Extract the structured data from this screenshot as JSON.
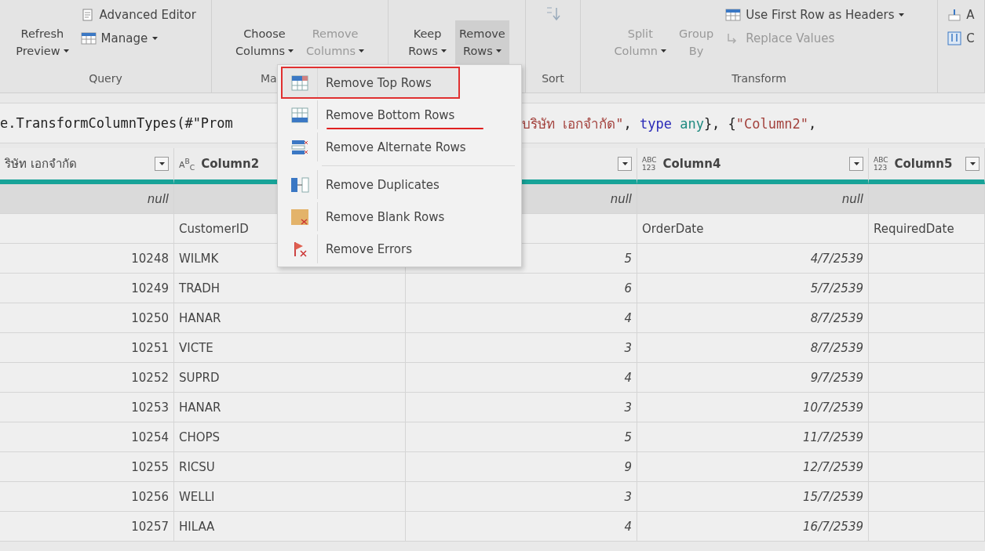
{
  "ribbon": {
    "groups": [
      {
        "label": "Query",
        "items": [
          {
            "kind": "large",
            "lines": [
              "Refresh",
              "Preview"
            ],
            "dropdown": true,
            "disabled": false,
            "pressed": false
          },
          {
            "kind": "stack",
            "items": [
              {
                "label": "Advanced Editor",
                "dropdown": false,
                "disabled": false
              },
              {
                "label": "Manage",
                "dropdown": true,
                "disabled": false
              }
            ]
          }
        ]
      },
      {
        "label": "Ma",
        "items": [
          {
            "kind": "large",
            "lines": [
              "Choose",
              "Columns"
            ],
            "dropdown": true,
            "disabled": false,
            "pressed": false
          },
          {
            "kind": "large",
            "lines": [
              "Remove",
              "Columns"
            ],
            "dropdown": true,
            "disabled": true,
            "pressed": false
          }
        ]
      },
      {
        "items": [
          {
            "kind": "large",
            "lines": [
              "Keep",
              "Rows"
            ],
            "dropdown": true,
            "disabled": false,
            "pressed": false
          },
          {
            "kind": "large",
            "lines": [
              "Remove",
              "Rows"
            ],
            "dropdown": true,
            "disabled": false,
            "pressed": true
          }
        ]
      },
      {
        "label": "Sort",
        "items": [
          {
            "kind": "sorticon"
          }
        ]
      },
      {
        "label": "Transform",
        "items": [
          {
            "kind": "large",
            "lines": [
              "Split",
              "Column"
            ],
            "dropdown": true,
            "disabled": true,
            "pressed": false
          },
          {
            "kind": "large",
            "lines": [
              "Group",
              "By"
            ],
            "dropdown": false,
            "disabled": true,
            "pressed": false
          },
          {
            "kind": "stack",
            "items": [
              {
                "label": "Use First Row as Headers",
                "dropdown": true,
                "disabled": false
              },
              {
                "label": "Replace Values",
                "dropdown": false,
                "disabled": true
              }
            ]
          }
        ]
      },
      {
        "items": [
          {
            "kind": "stack",
            "items": [
              {
                "label": "A",
                "dropdown": false,
                "disabled": false
              },
              {
                "label": "C",
                "dropdown": false,
                "disabled": false
              }
            ]
          }
        ]
      }
    ]
  },
  "formula": {
    "left": "e.TransformColumnTypes(#\"Prom",
    "right": [
      {
        "kind": "string",
        "text": "บริษัท เอกจำกัด\""
      },
      {
        "kind": "plain",
        "text": ", "
      },
      {
        "kind": "keyword",
        "text": "type"
      },
      {
        "kind": "type",
        "text": " any"
      },
      {
        "kind": "plain",
        "text": "}, {"
      },
      {
        "kind": "string",
        "text": "\"Column2\""
      },
      {
        "kind": "plain",
        "text": ","
      }
    ]
  },
  "table": {
    "columns": [
      {
        "name": "ริษัท เอกจำกัด"
      },
      {
        "name": "Column2",
        "type_label": "A$^{B}$$_{C}$"
      },
      {},
      {
        "name": "Column4",
        "type_lines": [
          "ABC",
          "123"
        ]
      },
      {
        "name": "Column5",
        "type_lines": [
          "ABC",
          "123"
        ]
      }
    ],
    "rows": [
      {
        "kind": "null",
        "cells": [
          "null",
          "",
          "null",
          "null",
          ""
        ]
      },
      {
        "kind": "names",
        "cells": [
          "",
          "CustomerID",
          "",
          "OrderDate",
          "RequiredDate"
        ]
      },
      {
        "kind": "data",
        "cells": [
          "10248",
          "WILMK",
          "5",
          "4/7/2539",
          ""
        ]
      },
      {
        "kind": "data",
        "cells": [
          "10249",
          "TRADH",
          "6",
          "5/7/2539",
          ""
        ]
      },
      {
        "kind": "data",
        "cells": [
          "10250",
          "HANAR",
          "4",
          "8/7/2539",
          ""
        ]
      },
      {
        "kind": "data",
        "cells": [
          "10251",
          "VICTE",
          "3",
          "8/7/2539",
          ""
        ]
      },
      {
        "kind": "data",
        "cells": [
          "10252",
          "SUPRD",
          "4",
          "9/7/2539",
          ""
        ]
      },
      {
        "kind": "data",
        "cells": [
          "10253",
          "HANAR",
          "3",
          "10/7/2539",
          ""
        ]
      },
      {
        "kind": "data",
        "cells": [
          "10254",
          "CHOPS",
          "5",
          "11/7/2539",
          ""
        ]
      },
      {
        "kind": "data",
        "cells": [
          "10255",
          "RICSU",
          "9",
          "12/7/2539",
          ""
        ]
      },
      {
        "kind": "data",
        "cells": [
          "10256",
          "WELLI",
          "3",
          "15/7/2539",
          ""
        ]
      },
      {
        "kind": "data",
        "cells": [
          "10257",
          "HILAA",
          "4",
          "16/7/2539",
          ""
        ]
      }
    ]
  },
  "menu": {
    "items": [
      {
        "label": "Remove Top Rows",
        "selected": true,
        "underlined": false,
        "separator_before": false
      },
      {
        "label": "Remove Bottom Rows",
        "selected": false,
        "underlined": true,
        "separator_before": false
      },
      {
        "label": "Remove Alternate Rows",
        "selected": false,
        "underlined": false,
        "separator_before": false
      },
      {
        "label": "Remove Duplicates",
        "selected": false,
        "underlined": false,
        "separator_before": true
      },
      {
        "label": "Remove Blank Rows",
        "selected": false,
        "underlined": false,
        "separator_before": false
      },
      {
        "label": "Remove Errors",
        "selected": false,
        "underlined": false,
        "separator_before": false
      }
    ]
  }
}
